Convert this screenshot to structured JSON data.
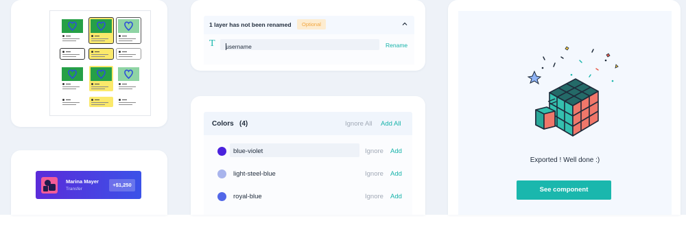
{
  "rename_card": {
    "title": "1 layer has not been renamed",
    "badge": "Optional",
    "field_value": "username",
    "action": "Rename"
  },
  "colors_card": {
    "title": "Colors",
    "count": "(4)",
    "ignore_all": "Ignore All",
    "add_all": "Add All",
    "rows": [
      {
        "name": "blue-violet",
        "color": "#4b22dd",
        "ignore": "Ignore",
        "add": "Add"
      },
      {
        "name": "light-steel-blue",
        "color": "#a8b4ec",
        "ignore": "Ignore",
        "add": "Add"
      },
      {
        "name": "royal-blue",
        "color": "#5267e8",
        "ignore": "Ignore",
        "add": "Add"
      }
    ]
  },
  "transfer_card": {
    "name": "Marina Mayer",
    "type": "Transfer",
    "amount": "+$1,250"
  },
  "export_card": {
    "message": "Exported ! Well done :)",
    "button": "See component",
    "illustration": "rubiks-cube-icon"
  },
  "colors": {
    "accent": "#1ab7ad",
    "badge_bg": "#fdecd0",
    "badge_text": "#f1a640",
    "background": "#eef2f8"
  }
}
